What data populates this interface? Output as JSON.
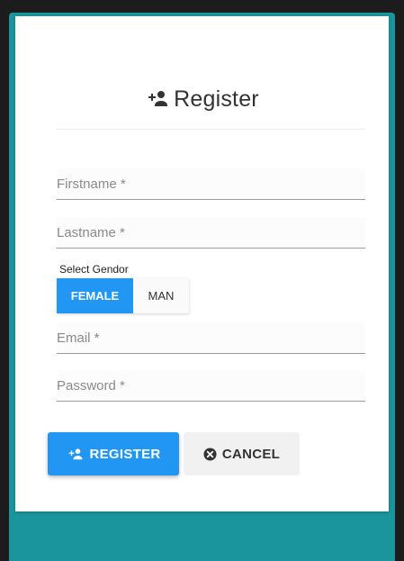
{
  "form": {
    "title": "Register",
    "fields": {
      "firstname": {
        "placeholder": "Firstname *",
        "value": ""
      },
      "lastname": {
        "placeholder": "Lastname *",
        "value": ""
      },
      "email": {
        "placeholder": "Email *",
        "value": ""
      },
      "password": {
        "placeholder": "Password *",
        "value": ""
      }
    },
    "gender": {
      "label": "Select Gendor",
      "options": [
        "FEMALE",
        "MAN"
      ],
      "selected": "FEMALE"
    },
    "buttons": {
      "register_label": "REGISTER",
      "cancel_label": "CANCEL"
    }
  },
  "icons": {
    "title_icon": "person-add-icon",
    "register_icon": "person-add-icon",
    "cancel_icon": "cancel-circle-icon"
  },
  "colors": {
    "primary": "#2196f3",
    "footer_teal": "#1a959d",
    "background": "#1c1c1c"
  }
}
